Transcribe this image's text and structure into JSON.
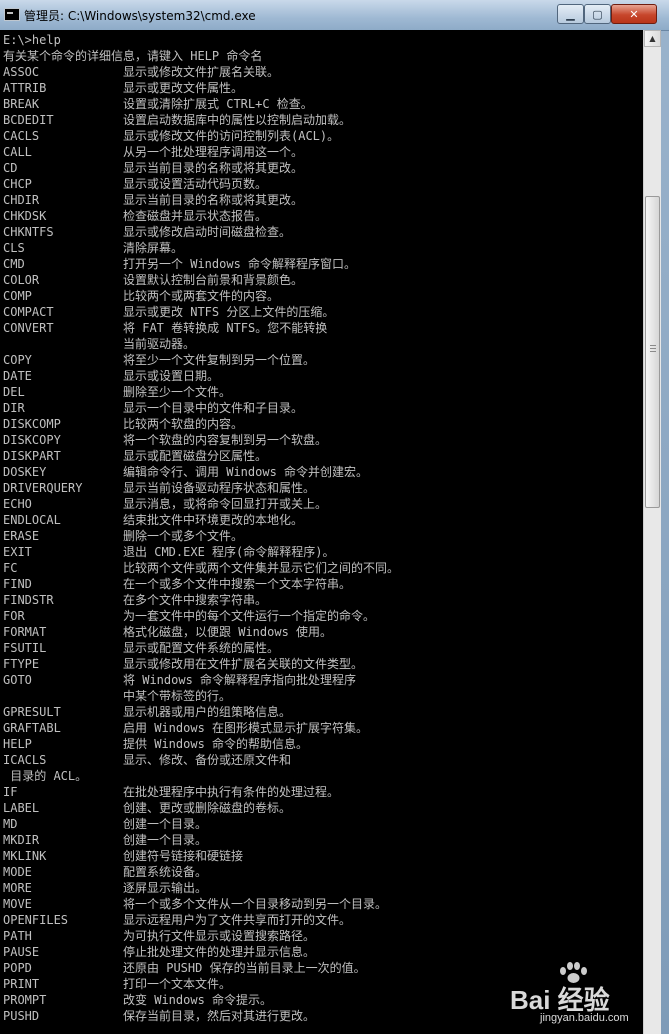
{
  "window": {
    "title": "管理员: C:\\Windows\\system32\\cmd.exe",
    "controls": {
      "minimize": "▁",
      "maximize": "▢",
      "close": "✕"
    }
  },
  "console": {
    "lines": [
      {
        "text": "E:\\>help"
      },
      {
        "text": "有关某个命令的详细信息，请键入 HELP 命令名"
      },
      {
        "cmd": "ASSOC",
        "desc": "显示或修改文件扩展名关联。"
      },
      {
        "cmd": "ATTRIB",
        "desc": "显示或更改文件属性。"
      },
      {
        "cmd": "BREAK",
        "desc": "设置或清除扩展式 CTRL+C 检查。"
      },
      {
        "cmd": "BCDEDIT",
        "desc": "设置启动数据库中的属性以控制启动加载。"
      },
      {
        "cmd": "CACLS",
        "desc": "显示或修改文件的访问控制列表(ACL)。"
      },
      {
        "cmd": "CALL",
        "desc": "从另一个批处理程序调用这一个。"
      },
      {
        "cmd": "CD",
        "desc": "显示当前目录的名称或将其更改。"
      },
      {
        "cmd": "CHCP",
        "desc": "显示或设置活动代码页数。"
      },
      {
        "cmd": "CHDIR",
        "desc": "显示当前目录的名称或将其更改。"
      },
      {
        "cmd": "CHKDSK",
        "desc": "检查磁盘并显示状态报告。"
      },
      {
        "cmd": "CHKNTFS",
        "desc": "显示或修改启动时间磁盘检查。"
      },
      {
        "cmd": "CLS",
        "desc": "清除屏幕。"
      },
      {
        "cmd": "CMD",
        "desc": "打开另一个 Windows 命令解释程序窗口。"
      },
      {
        "cmd": "COLOR",
        "desc": "设置默认控制台前景和背景颜色。"
      },
      {
        "cmd": "COMP",
        "desc": "比较两个或两套文件的内容。"
      },
      {
        "cmd": "COMPACT",
        "desc": "显示或更改 NTFS 分区上文件的压缩。"
      },
      {
        "cmd": "CONVERT",
        "desc": "将 FAT 卷转换成 NTFS。您不能转换"
      },
      {
        "cmd": "",
        "desc": "当前驱动器。"
      },
      {
        "cmd": "COPY",
        "desc": "将至少一个文件复制到另一个位置。"
      },
      {
        "cmd": "DATE",
        "desc": "显示或设置日期。"
      },
      {
        "cmd": "DEL",
        "desc": "删除至少一个文件。"
      },
      {
        "cmd": "DIR",
        "desc": "显示一个目录中的文件和子目录。"
      },
      {
        "cmd": "DISKCOMP",
        "desc": "比较两个软盘的内容。"
      },
      {
        "cmd": "DISKCOPY",
        "desc": "将一个软盘的内容复制到另一个软盘。"
      },
      {
        "cmd": "DISKPART",
        "desc": "显示或配置磁盘分区属性。"
      },
      {
        "cmd": "DOSKEY",
        "desc": "编辑命令行、调用 Windows 命令并创建宏。"
      },
      {
        "cmd": "DRIVERQUERY",
        "desc": "显示当前设备驱动程序状态和属性。"
      },
      {
        "cmd": "ECHO",
        "desc": "显示消息，或将命令回显打开或关上。"
      },
      {
        "cmd": "ENDLOCAL",
        "desc": "结束批文件中环境更改的本地化。"
      },
      {
        "cmd": "ERASE",
        "desc": "删除一个或多个文件。"
      },
      {
        "cmd": "EXIT",
        "desc": "退出 CMD.EXE 程序(命令解释程序)。"
      },
      {
        "cmd": "FC",
        "desc": "比较两个文件或两个文件集并显示它们之间的不同。"
      },
      {
        "cmd": "FIND",
        "desc": "在一个或多个文件中搜索一个文本字符串。"
      },
      {
        "cmd": "FINDSTR",
        "desc": "在多个文件中搜索字符串。"
      },
      {
        "cmd": "FOR",
        "desc": "为一套文件中的每个文件运行一个指定的命令。"
      },
      {
        "cmd": "FORMAT",
        "desc": "格式化磁盘，以便跟 Windows 使用。"
      },
      {
        "cmd": "FSUTIL",
        "desc": "显示或配置文件系统的属性。"
      },
      {
        "cmd": "FTYPE",
        "desc": "显示或修改用在文件扩展名关联的文件类型。"
      },
      {
        "cmd": "GOTO",
        "desc": "将 Windows 命令解释程序指向批处理程序"
      },
      {
        "cmd": "",
        "desc": "中某个带标签的行。"
      },
      {
        "cmd": "GPRESULT",
        "desc": "显示机器或用户的组策略信息。"
      },
      {
        "cmd": "GRAFTABL",
        "desc": "启用 Windows 在图形模式显示扩展字符集。"
      },
      {
        "cmd": "HELP",
        "desc": "提供 Windows 命令的帮助信息。"
      },
      {
        "cmd": "ICACLS",
        "desc": "显示、修改、备份或还原文件和"
      },
      {
        "text": " 目录的 ACL。"
      },
      {
        "cmd": "IF",
        "desc": "在批处理程序中执行有条件的处理过程。"
      },
      {
        "cmd": "LABEL",
        "desc": "创建、更改或删除磁盘的卷标。"
      },
      {
        "cmd": "MD",
        "desc": "创建一个目录。"
      },
      {
        "cmd": "MKDIR",
        "desc": "创建一个目录。"
      },
      {
        "cmd": "MKLINK",
        "desc": "创建符号链接和硬链接"
      },
      {
        "cmd": "MODE",
        "desc": "配置系统设备。"
      },
      {
        "cmd": "MORE",
        "desc": "逐屏显示输出。"
      },
      {
        "cmd": "MOVE",
        "desc": "将一个或多个文件从一个目录移动到另一个目录。"
      },
      {
        "cmd": "OPENFILES",
        "desc": "显示远程用户为了文件共享而打开的文件。"
      },
      {
        "cmd": "PATH",
        "desc": "为可执行文件显示或设置搜索路径。"
      },
      {
        "cmd": "PAUSE",
        "desc": "停止批处理文件的处理并显示信息。"
      },
      {
        "cmd": "POPD",
        "desc": "还原由 PUSHD 保存的当前目录上一次的值。"
      },
      {
        "cmd": "PRINT",
        "desc": "打印一个文本文件。"
      },
      {
        "cmd": "PROMPT",
        "desc": "改变 Windows 命令提示。"
      },
      {
        "cmd": "PUSHD",
        "desc": "保存当前目录，然后对其进行更改。"
      }
    ]
  },
  "scrollbar": {
    "up_arrow": "▲",
    "thumb_position": 0.22
  },
  "watermark": {
    "brand": "Bai 经验",
    "url": "jingyan.baidu.com"
  },
  "colors": {
    "console_bg": "#000000",
    "console_fg": "#c0c0c0",
    "close_button": "#c7462b",
    "titlebar": "#9fb9d3"
  }
}
